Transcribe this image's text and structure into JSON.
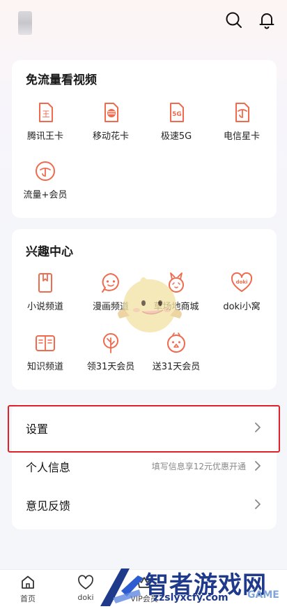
{
  "header": {
    "search_icon": "search-icon",
    "bell_icon": "bell-icon"
  },
  "free_data": {
    "title": "免流量看视频",
    "items": [
      {
        "label": "腾讯王卡",
        "icon": "wang-card-icon",
        "glyph": "王"
      },
      {
        "label": "移动花卡",
        "icon": "hua-card-icon",
        "glyph": ""
      },
      {
        "label": "极速5G",
        "icon": "5g-icon",
        "glyph": "5G"
      },
      {
        "label": "电信星卡",
        "icon": "telecom-card-icon",
        "glyph": ""
      },
      {
        "label": "流量+会员",
        "icon": "data-member-icon",
        "glyph": ""
      }
    ]
  },
  "interest": {
    "title": "兴趣中心",
    "items": [
      {
        "label": "小说频道",
        "icon": "book-icon"
      },
      {
        "label": "漫画频道",
        "icon": "comic-face-icon"
      },
      {
        "label": "草场地商城",
        "icon": "bunny-icon"
      },
      {
        "label": "doki小窝",
        "icon": "doki-heart-icon",
        "glyph": "doki"
      },
      {
        "label": "知识频道",
        "icon": "open-book-icon"
      },
      {
        "label": "领31天会员",
        "icon": "tree-icon"
      },
      {
        "label": "送31天会员",
        "icon": "gift-face-icon"
      }
    ]
  },
  "settings": {
    "rows": [
      {
        "label": "设置",
        "hint": ""
      },
      {
        "label": "个人信息",
        "hint": "填写信息享12元优惠开通"
      },
      {
        "label": "意见反馈",
        "hint": ""
      }
    ]
  },
  "tabbar": {
    "tabs": [
      {
        "label": "首页",
        "icon": "home-icon"
      },
      {
        "label": "doki",
        "icon": "doki-tab-icon"
      },
      {
        "label": "VIP会员",
        "icon": "vip-icon"
      }
    ]
  },
  "watermark": {
    "title": "智者游戏网",
    "url": "zzslyxcfy.com",
    "game": "GAME"
  },
  "colors": {
    "accent": "#f06a4d",
    "highlight": "#e0212a",
    "watermark": "#1f3a8a"
  }
}
